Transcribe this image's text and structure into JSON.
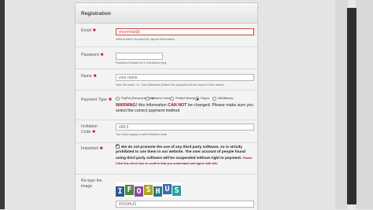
{
  "form": {
    "title": "Registration",
    "email": {
      "label": "Email",
      "value": "youremail@",
      "help": "Valid email is required for payout information"
    },
    "password": {
      "label": "Password",
      "value": "",
      "help": "Password should be 6 characters long"
    },
    "name": {
      "label": "Name",
      "value": "your name",
      "help": "Your full name, i.e. John Abraham (Name the payment will be issued in this name)"
    },
    "payment": {
      "label": "Payment Type",
      "options": [
        "PayPal (Recommended)",
        "Western Union",
        "Perfect Money",
        "Payza",
        "WebMoney"
      ],
      "warning_word": "WARNING!",
      "warning_text_1": "this information",
      "warning_cannot": "CAN NOT",
      "warning_text_2": "be changed. Please make sure you select the correct payment method"
    },
    "invitation": {
      "label": "Invitation Code",
      "value": "sML5",
      "help": "You must supply a valid invitation code"
    },
    "important": {
      "label": "Important",
      "text": "We do not promote the use of any third party software, so is strictly prohibited to use them in our website. The user account of people found using third party software will be suspended without right to payment.",
      "please": "Please",
      "small": "Click this check box to confirm that you understand and agree with this."
    },
    "captcha": {
      "label": "Re-type the image",
      "letters": [
        "I",
        "F",
        "O",
        "S",
        "H",
        "U",
        "S"
      ],
      "value": "IFOSHUS"
    }
  },
  "colors": {
    "required": "#b22222",
    "warning": "#a01818",
    "captcha": [
      "#2a5c8a",
      "#4a8a3a",
      "#8a4a9a",
      "#b0a020",
      "#2a7a8a",
      "#3a6ab0",
      "#2aa0a0"
    ]
  }
}
